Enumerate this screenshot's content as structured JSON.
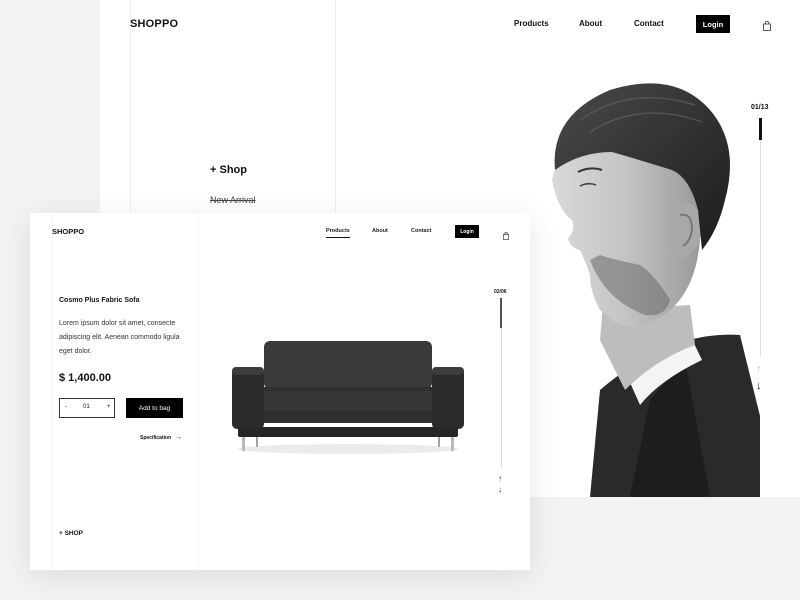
{
  "back": {
    "logo": "SHOPPO",
    "nav": {
      "products": "Products",
      "about": "About",
      "contact": "Contact",
      "login": "Login"
    },
    "shop_title": "+ Shop",
    "new_arrival": "New Arrival",
    "counter": "01/13"
  },
  "front": {
    "logo": "SHOPPO",
    "nav": {
      "products": "Products",
      "about": "About",
      "contact": "Contact",
      "login": "Login"
    },
    "product": {
      "name": "Cosmo Plus Fabric Sofa",
      "description": "Lorem ipsum dolor sit amet, consecte adipiscing elit. Aenean commodo ligula eget dolor.",
      "price": "$ 1,400.00"
    },
    "quantity": {
      "minus": "-",
      "value": "01",
      "plus": "+"
    },
    "add_to_bag": "Add to bag",
    "specification": "Specification",
    "shop_link": "+ SHOP",
    "counter": "02/06"
  },
  "icons": {
    "bag": "shopping-bag-icon",
    "arrow_up": "↑",
    "arrow_down": "↓",
    "arrow_right": "→"
  },
  "colors": {
    "accent": "#000000",
    "background": "#f3f3f3",
    "card": "#ffffff"
  }
}
